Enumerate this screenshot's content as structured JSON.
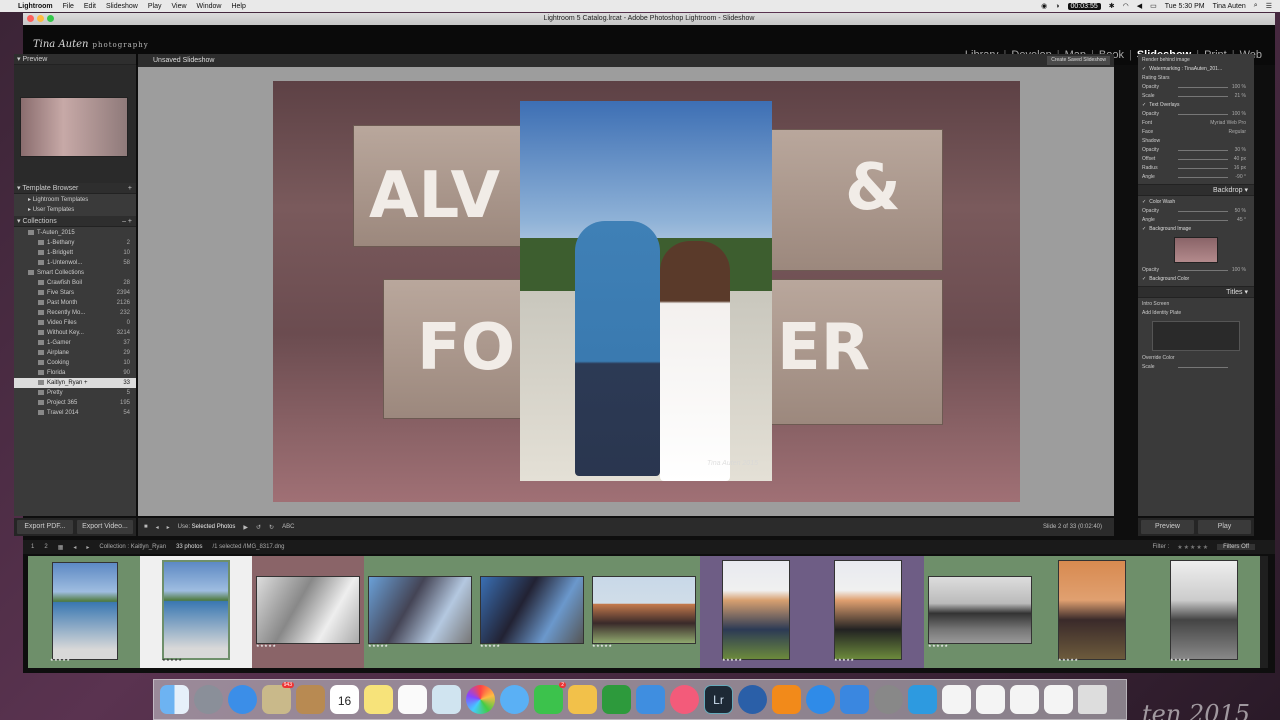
{
  "menubar": {
    "app": "Lightroom",
    "items": [
      "File",
      "Edit",
      "Slideshow",
      "Play",
      "View",
      "Window",
      "Help"
    ],
    "timer": "00:03:55",
    "clock": "Tue 5:30 PM",
    "user": "Tina Auten"
  },
  "window": {
    "title": "Lightroom 5 Catalog.lrcat - Adobe Photoshop Lightroom - Slideshow"
  },
  "identity": {
    "name": "Tina Auten",
    "sub": "photography"
  },
  "modules": [
    "Library",
    "Develop",
    "Map",
    "Book",
    "Slideshow",
    "Print",
    "Web"
  ],
  "active_module": "Slideshow",
  "left": {
    "preview_label": "Preview",
    "template_browser_label": "Template Browser",
    "templates": [
      "Lightroom Templates",
      "User Templates"
    ],
    "collections_label": "Collections",
    "collections": [
      {
        "name": "T-Auten_2015",
        "count": ""
      },
      {
        "name": "1-Bethany",
        "count": "2"
      },
      {
        "name": "1-Bridgett",
        "count": "10"
      },
      {
        "name": "1-Untenwol...",
        "count": "58"
      },
      {
        "name": "Smart Collections",
        "count": ""
      },
      {
        "name": "Crawfish Boil",
        "count": "28"
      },
      {
        "name": "Five Stars",
        "count": "2394"
      },
      {
        "name": "Past Month",
        "count": "2126"
      },
      {
        "name": "Recently Mo...",
        "count": "232"
      },
      {
        "name": "Video Files",
        "count": "0"
      },
      {
        "name": "Without Key...",
        "count": "3214"
      },
      {
        "name": "1-Gamer",
        "count": "37"
      },
      {
        "name": "Airplane",
        "count": "29"
      },
      {
        "name": "Cooking",
        "count": "10"
      },
      {
        "name": "Florida",
        "count": "90"
      },
      {
        "name": "Kaitlyn_Ryan  +",
        "count": "33"
      },
      {
        "name": "Pretty",
        "count": "5"
      },
      {
        "name": "Project 365",
        "count": "195"
      },
      {
        "name": "Travel 2014",
        "count": "54"
      }
    ],
    "export_pdf": "Export PDF...",
    "export_video": "Export Video..."
  },
  "center": {
    "title": "Unsaved Slideshow",
    "create_saved": "Create Saved Slideshow",
    "block_text_1": "ALV",
    "block_text_2": "&",
    "block_text_3": "FO",
    "block_text_4": "ER",
    "watermark": "Tina Auten 2015"
  },
  "toolbar": {
    "use_label": "Use:",
    "use_value": "Selected Photos",
    "abc": "ABC",
    "slide_count": "Slide 2 of 33 (0:02:40)"
  },
  "right": {
    "rows": [
      {
        "label": "Render behind image",
        "value": ""
      },
      {
        "label": "Watermarking : TinaAuten_201...",
        "value": "",
        "header": true
      },
      {
        "label": "Rating Stars",
        "value": ""
      },
      {
        "label": "Opacity",
        "value": "100 %"
      },
      {
        "label": "Scale",
        "value": "21 %"
      },
      {
        "label": "Text Overlays",
        "value": "",
        "header": true
      },
      {
        "label": "Opacity",
        "value": "100 %"
      },
      {
        "label": "Font",
        "value": "Myriad Web Pro"
      },
      {
        "label": "Face",
        "value": "Regular"
      },
      {
        "label": "Shadow",
        "value": ""
      },
      {
        "label": "Opacity",
        "value": "30 %"
      },
      {
        "label": "Offset",
        "value": "40 px"
      },
      {
        "label": "Radius",
        "value": "16 px"
      },
      {
        "label": "Angle",
        "value": "-90 °"
      }
    ],
    "backdrop_label": "Backdrop",
    "backdrop_rows": [
      {
        "label": "Color Wash",
        "value": "",
        "header": true
      },
      {
        "label": "Opacity",
        "value": "50 %"
      },
      {
        "label": "Angle",
        "value": "45 °"
      },
      {
        "label": "Background Image",
        "value": "",
        "header": true
      },
      {
        "label": "Opacity",
        "value": "100 %"
      },
      {
        "label": "Background Color",
        "value": "",
        "header": true
      }
    ],
    "titles_label": "Titles",
    "titles_rows": [
      {
        "label": "Intro Screen",
        "value": ""
      },
      {
        "label": "Add Identity Plate",
        "value": ""
      },
      {
        "label": "Override Color",
        "value": ""
      },
      {
        "label": "Scale",
        "value": ""
      }
    ],
    "preview_btn": "Preview",
    "play_btn": "Play"
  },
  "filmstrip": {
    "page1": "1",
    "page2": "2",
    "collection": "Collection : Kaitlyn_Ryan",
    "count": "33 photos",
    "selected": "/1 selected /IMG_8317.dng",
    "filter_label": "Filter :",
    "filters_off": "Filters Off",
    "stars": "★★★★★",
    "thumb_stars": "★★★★★"
  },
  "dock": {
    "badge_photos": "943",
    "badge_facetime": "2",
    "calendar_day": "16",
    "lr_label": "Lr"
  },
  "signature": "ten 2015",
  "colors": {
    "lr_bg": "#3a3a3a",
    "filmstrip_green": "#6e8f6a",
    "filmstrip_purple": "#6e5d85",
    "filmstrip_rose": "#8a6468"
  }
}
